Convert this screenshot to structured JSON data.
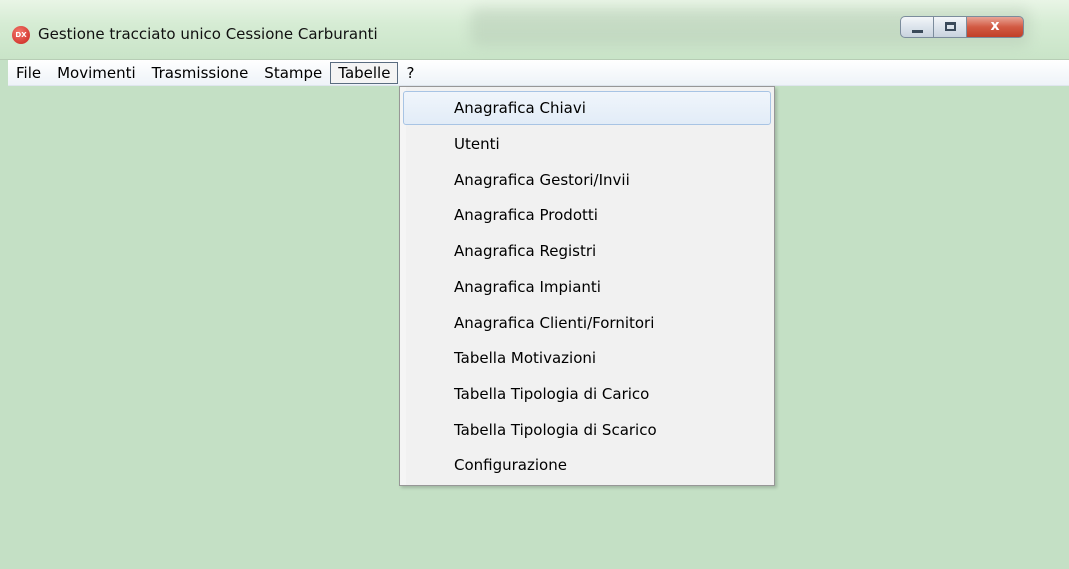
{
  "window": {
    "title": "Gestione tracciato unico Cessione Carburanti",
    "app_icon_text": "DX",
    "controls": {
      "minimize_icon": "minimize-icon",
      "maximize_icon": "maximize-icon",
      "close_icon": "close-icon",
      "close_glyph": "x"
    }
  },
  "menubar": {
    "items": [
      {
        "label": "File"
      },
      {
        "label": "Movimenti"
      },
      {
        "label": "Trasmissione"
      },
      {
        "label": "Stampe"
      },
      {
        "label": "Tabelle",
        "active": true
      },
      {
        "label": "?"
      }
    ]
  },
  "dropdown": {
    "parent": "Tabelle",
    "items": [
      {
        "label": "Anagrafica Chiavi",
        "highlighted": true
      },
      {
        "label": "Utenti"
      },
      {
        "label": "Anagrafica Gestori/Invii"
      },
      {
        "label": "Anagrafica Prodotti"
      },
      {
        "label": "Anagrafica Registri"
      },
      {
        "label": "Anagrafica Impianti"
      },
      {
        "label": "Anagrafica Clienti/Fornitori"
      },
      {
        "label": "Tabella Motivazioni"
      },
      {
        "label": "Tabella Tipologia di Carico"
      },
      {
        "label": "Tabella Tipologia di Scarico"
      },
      {
        "label": "Configurazione"
      }
    ]
  },
  "colors": {
    "client_area": "#c4e0c5",
    "highlight_border": "#a8c4e4",
    "close_button": "#c13f28"
  }
}
